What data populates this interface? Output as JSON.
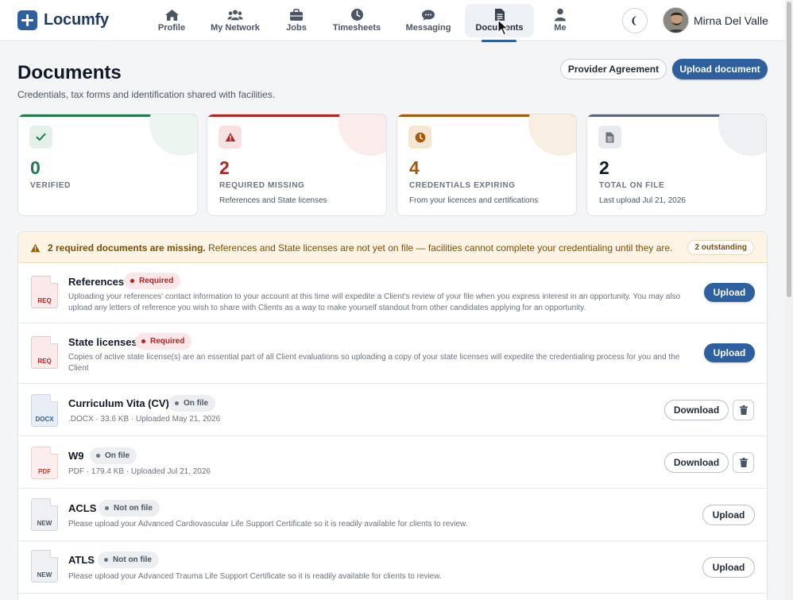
{
  "app": {
    "name": "Locumfy"
  },
  "nav": [
    {
      "label": "Profile",
      "icon": "home-icon"
    },
    {
      "label": "My Network",
      "icon": "users-icon"
    },
    {
      "label": "Jobs",
      "icon": "briefcase-icon"
    },
    {
      "label": "Timesheets",
      "icon": "clock-icon"
    },
    {
      "label": "Messaging",
      "icon": "chat-icon"
    },
    {
      "label": "Documents",
      "icon": "document-icon",
      "active": true
    },
    {
      "label": "Me",
      "icon": "person-icon"
    }
  ],
  "user": {
    "name": "Mirna Del Valle"
  },
  "page": {
    "title": "Documents",
    "subtitle": "Credentials, tax forms and identification shared with facilities.",
    "provider_agreement_label": "Provider Agreement",
    "upload_document_label": "Upload document"
  },
  "stats": [
    {
      "value": "0",
      "label": "Verified",
      "sub": "",
      "color": "#1f7a4d",
      "icon": "check-icon"
    },
    {
      "value": "2",
      "label": "Required missing",
      "sub": "References and State licenses",
      "color": "#b42323",
      "icon": "warning-icon"
    },
    {
      "value": "4",
      "label": "Credentials expiring",
      "sub": "From your licences and certifications",
      "color": "#a35a08",
      "icon": "clock-icon"
    },
    {
      "value": "2",
      "label": "Total on file",
      "sub": "Last upload Jul 21, 2026",
      "color": "#1f2937",
      "icon": "document-icon"
    }
  ],
  "alert": {
    "strong": "2 required documents are missing.",
    "text": " References and State licenses are not yet on file — facilities cannot complete your credentialing until they are.",
    "badge": "2 outstanding"
  },
  "documents": [
    {
      "title": "References",
      "status": "Required",
      "file_tag": "REQ",
      "description": "Uploading your references' contact information to your account at this time will expedite a Client's review of your file when you express interest in an opportunity. You may also upload any letters of reference you wish to share with Clients as a way to make yourself standout from other candidates applying for an opportunity.",
      "action": "Upload"
    },
    {
      "title": "State licenses",
      "status": "Required",
      "file_tag": "REQ",
      "description": "Copies of active state license(s) are an essential part of all Client evaluations so uploading a copy of your state licenses will expedite the credentialing process for you and the Client",
      "action": "Upload"
    },
    {
      "title": "Curriculum Vita (CV)",
      "status": "On file",
      "file_tag": "DOCX",
      "meta": ".DOCX · 33.6 KB · Uploaded May 21, 2026",
      "action": "Download"
    },
    {
      "title": "W9",
      "status": "On file",
      "file_tag": "PDF",
      "meta": "PDF · 179.4 KB · Uploaded Jul 21, 2026",
      "action": "Download"
    },
    {
      "title": "ACLS",
      "status": "Not on file",
      "file_tag": "NEW",
      "meta": "Please upload your Advanced Cardiovascular Life Support Certificate so it is readily available for clients to review.",
      "action": "Upload"
    },
    {
      "title": "ATLS",
      "status": "Not on file",
      "file_tag": "NEW",
      "meta": "Please upload your Advanced Trauma Life Support Certificate so it is readily available for clients to review.",
      "action": "Upload"
    }
  ],
  "colors": {
    "brand": "#2e5f9e",
    "required": "#b42323",
    "warning": "#a35a08",
    "verified": "#1f7a4d"
  }
}
